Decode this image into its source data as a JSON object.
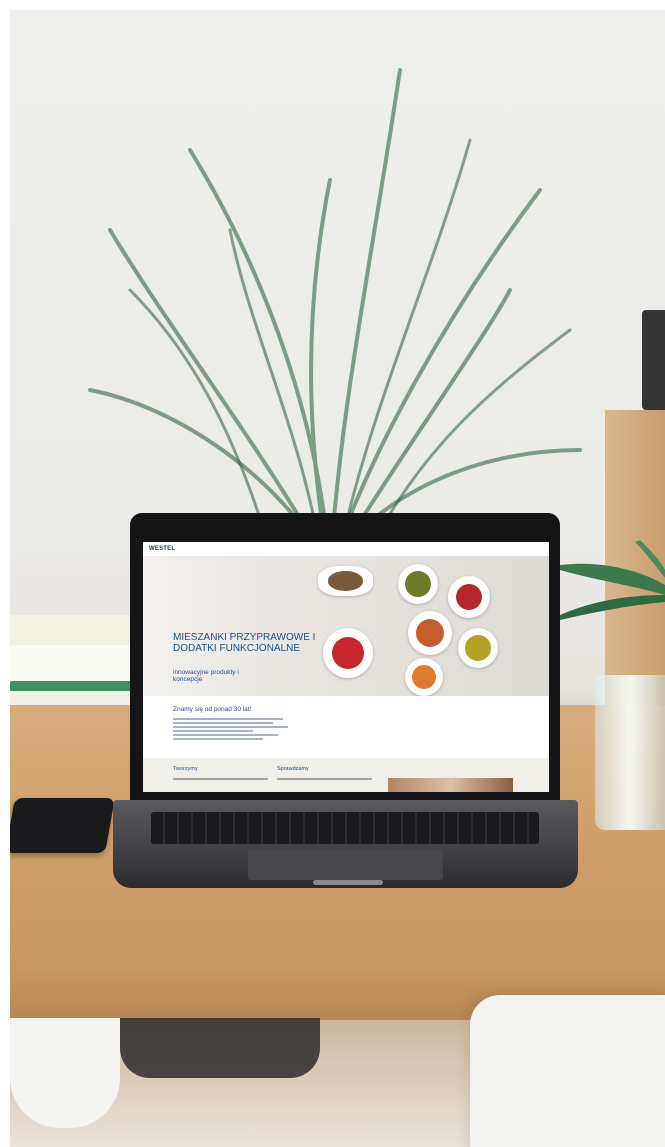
{
  "site": {
    "logo": "WESTEL",
    "nav": [
      "",
      "",
      "",
      ""
    ],
    "hero_title": "MIESZANKI PRZYPRAWOWE I DODATKI FUNKCJONALNE",
    "hero_subtitle": "innowacyjne produkty i koncepcje",
    "section2_title": "Znamy się od ponad 30 lat!",
    "section3_col1": "Tworzymy",
    "section3_col2": "Sprawdzamy"
  },
  "colors": {
    "brand_blue": "#1c4f8c",
    "desk_wood": "#cfa06c"
  }
}
